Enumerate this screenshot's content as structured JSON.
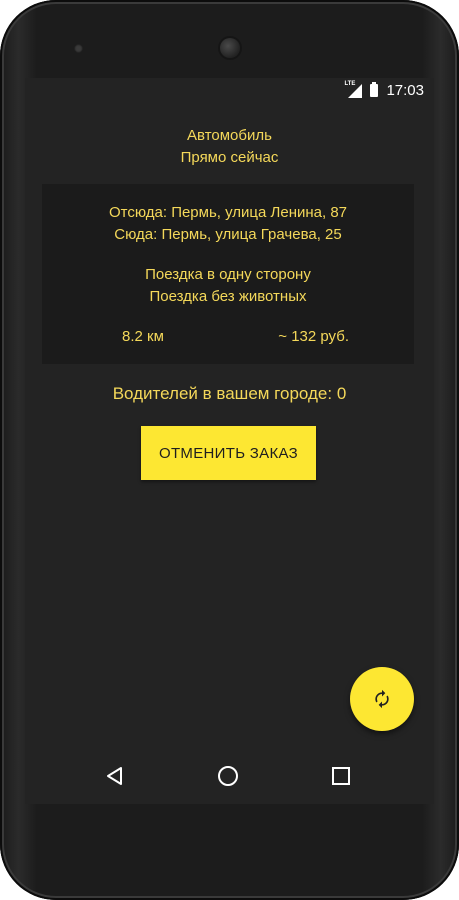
{
  "status_bar": {
    "network": "LTE",
    "time": "17:03"
  },
  "order": {
    "vehicle": "Автомобиль",
    "when": "Прямо сейчас"
  },
  "trip": {
    "from": "Отсюда: Пермь, улица Ленина, 87",
    "to": "Сюда: Пермь, улица Грачева, 25",
    "option_1": "Поездка в одну сторону",
    "option_2": "Поездка без животных",
    "distance": "8.2 км",
    "price": "~ 132 руб."
  },
  "drivers_text": "Водителей в вашем городе: 0",
  "cancel_button": "ОТМЕНИТЬ ЗАКАЗ",
  "icons": {
    "fab": "refresh-icon",
    "back": "back-icon",
    "home": "home-icon",
    "recents": "recents-icon"
  },
  "colors": {
    "accent": "#fde732",
    "text_accent": "#f4d85a",
    "background": "#232323",
    "card": "#1b1b1b"
  }
}
